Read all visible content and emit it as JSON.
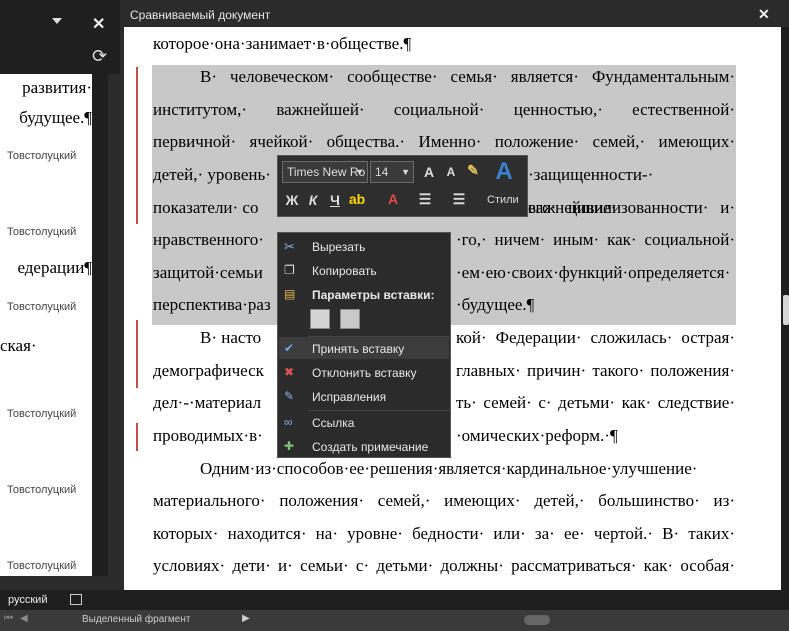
{
  "left_pane": {
    "lines": [
      "развития·",
      "будущее.¶",
      "едерации¶",
      "ская·"
    ],
    "authors": [
      "Товстолуцкий",
      "Товстолуцкий",
      "Товстолуцкий",
      "Товстолуцкий",
      "Товстолуцкий",
      "Товстолуцкий"
    ]
  },
  "window": {
    "title": "Сравниваемый документ",
    "close": "✕"
  },
  "document": {
    "line0": "которое·она·занимает·в·обществе.¶",
    "p1": [
      "В· человеческом· сообществе· семья· является· Фундаментальным·",
      "институтом,· важнейшей· социальной· ценностью,· естественной·",
      "первичной· ячейкой· общества.· Именно· положение· семей,· имеющих·",
      "детей,· уровень·",
      "·защищенности-· важнейшие·",
      "показатели· со",
      "его· цивилизованности· и·",
      "нравственного·",
      "·го,· ничем· иным· как· социальной·",
      "защитой·семьи",
      "·ем·ею·своих·функций·определяется·",
      "перспектива·раз",
      "·будущее.¶"
    ],
    "p2": [
      "В· насто",
      "кой· Федерации· сложилась· острая·",
      "демографическ",
      "главных· причин· такого· положения·",
      "дел·-·материал",
      "ть· семей· с· детьми· как· следствие·",
      "проводимых·в·",
      "·омических·реформ.·¶"
    ],
    "p3": [
      "Одним·из·способов·ее·решения·является·кардинальное·улучшение·",
      "материального· положения· семей,· имеющих· детей,· большинство· из·",
      "которых· находится· на· уровне· бедности· или· за· ее· чертой.· В· таких·",
      "условиях· дети· и· семьи· с· детьми· должны· рассматриваться· как· особая·"
    ]
  },
  "mini_toolbar": {
    "font_name": "Times New Ro",
    "font_size": "14",
    "bold": "Ж",
    "italic": "К",
    "underline": "Ч",
    "styles_label": "Стили"
  },
  "context_menu": {
    "cut": "Вырезать",
    "copy": "Копировать",
    "paste_header": "Параметры вставки:",
    "accept": "Принять вставку",
    "reject": "Отклонить вставку",
    "revisions": "Исправления",
    "link": "Ссылка",
    "comment": "Создать примечание"
  },
  "status": {
    "language": "русский",
    "selection": "Выделенный фрагмент"
  },
  "colors": {
    "highlight": "#c8c8c8",
    "change_bar": "#c0504d",
    "accent": "#2e75b6"
  }
}
